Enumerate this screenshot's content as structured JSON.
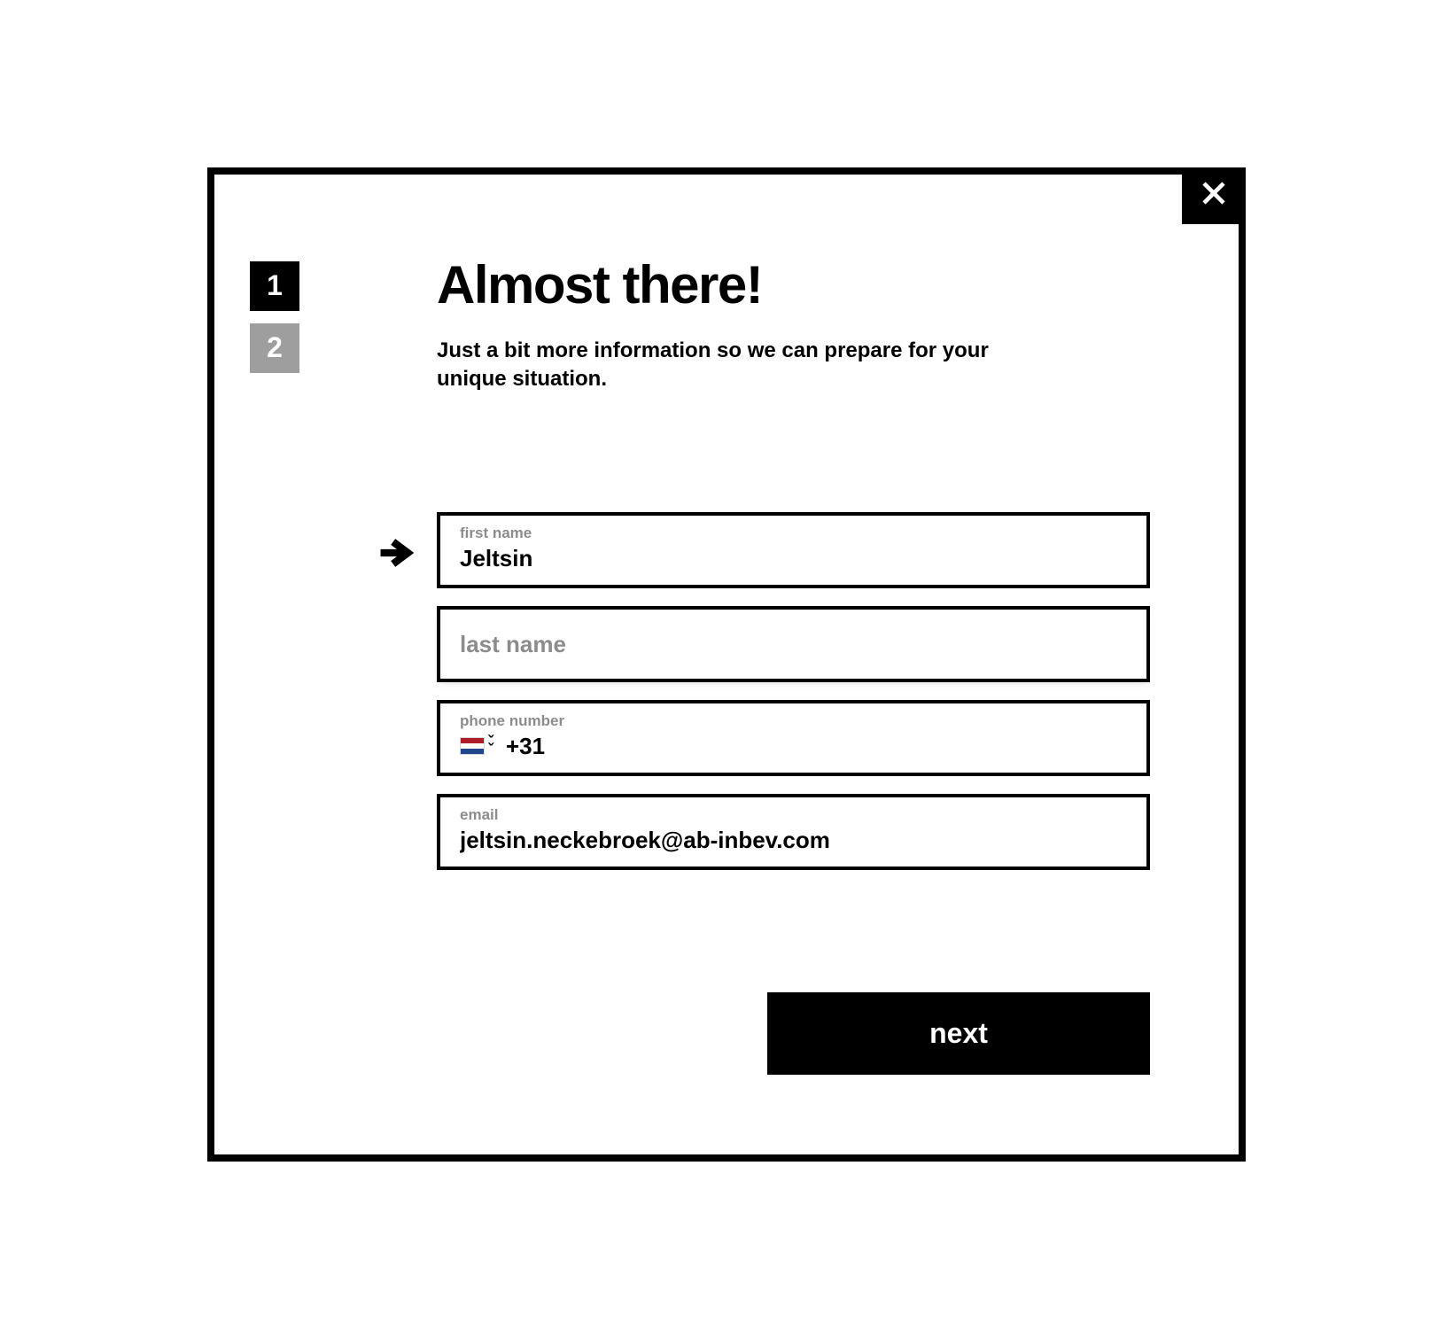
{
  "steps": {
    "first": "1",
    "second": "2"
  },
  "heading": {
    "title": "Almost there!",
    "subtitle": "Just a bit more information so we can prepare for your unique situation."
  },
  "fields": {
    "first_name": {
      "label": "first name",
      "value": "Jeltsin"
    },
    "last_name": {
      "placeholder": "last name",
      "value": ""
    },
    "phone": {
      "label": "phone number",
      "country": "NL",
      "prefix": "+31",
      "value": ""
    },
    "email": {
      "label": "email",
      "value": "jeltsin.neckebroek@ab-inbev.com"
    }
  },
  "next_label": "next"
}
